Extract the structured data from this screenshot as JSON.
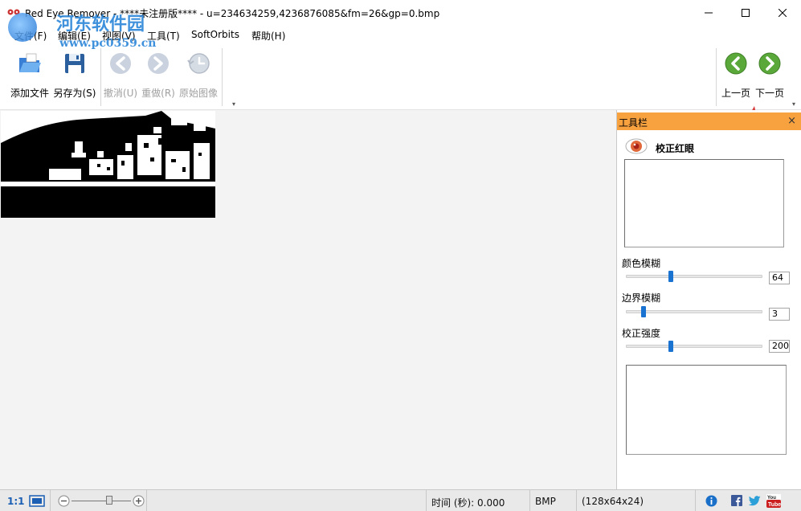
{
  "window": {
    "title": "Red Eye Remover - ****未注册版**** - u=234634259,4236876085&fm=26&gp=0.bmp"
  },
  "watermark": {
    "text": "河东软件园",
    "url": "www.pc0359.cn"
  },
  "menu": [
    {
      "label": "文件(F)"
    },
    {
      "label": "编辑(E)"
    },
    {
      "label": "视图(V)"
    },
    {
      "label": "工具(T)"
    },
    {
      "label": "SoftOrbits"
    },
    {
      "label": "帮助(H)"
    }
  ],
  "toolbar": {
    "add_file": "添加文件",
    "save_as": "另存为(S)",
    "undo": "撤消(U)",
    "redo": "重做(R)",
    "original": "原始图像",
    "prev_page": "上一页",
    "next_page": "下一页"
  },
  "panel": {
    "title": "工具栏",
    "close_glyph": "×",
    "tool_name": "校正红眼",
    "sliders": [
      {
        "label": "颜色模糊",
        "value": "64",
        "fraction": 0.32
      },
      {
        "label": "边界模糊",
        "value": "3",
        "fraction": 0.11
      },
      {
        "label": "校正强度",
        "value": "200",
        "fraction": 0.32
      }
    ]
  },
  "statusbar": {
    "zoom_ratio": "1:1",
    "zoom_fraction": 0.65,
    "time_label": "时间 (秒): 0.000",
    "format": "BMP",
    "dimensions": "(128x64x24)"
  },
  "colors": {
    "panel_header": "#f7a13f",
    "accent_blue": "#1a73d1",
    "nav_green": "#5aa83a"
  }
}
